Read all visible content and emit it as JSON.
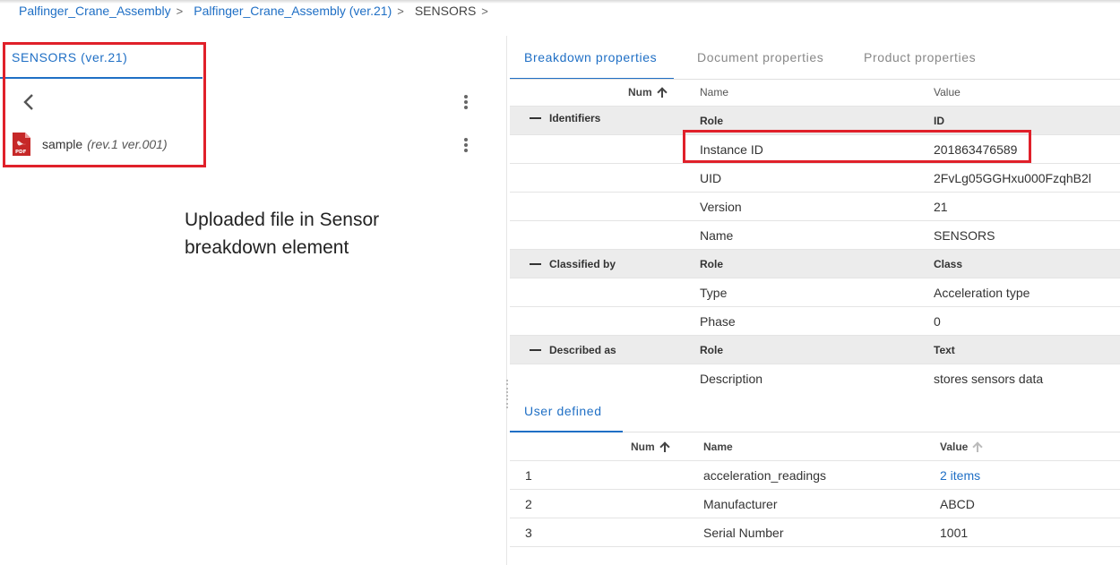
{
  "breadcrumb": {
    "items": [
      "Palfinger_Crane_Assembly",
      "Palfinger_Crane_Assembly (ver.21)"
    ],
    "current": "SENSORS"
  },
  "left_panel": {
    "tab_label": "SENSORS (ver.21)",
    "file": {
      "name": "sample",
      "revision": "(rev.1 ver.001)",
      "icon": "pdf-icon"
    },
    "annotation": "Uploaded file in Sensor breakdown element"
  },
  "tabs": [
    "Breakdown properties",
    "Document properties",
    "Product properties"
  ],
  "properties": {
    "headers": {
      "num": "Num",
      "name": "Name",
      "value": "Value"
    },
    "groups": [
      {
        "label": "Identifiers",
        "col_name": "Role",
        "col_value": "ID",
        "rows": [
          {
            "name": "Instance ID",
            "value": "201863476589"
          },
          {
            "name": "UID",
            "value": "2FvLg05GGHxu000FzqhB2l"
          },
          {
            "name": "Version",
            "value": "21"
          },
          {
            "name": "Name",
            "value": "SENSORS"
          }
        ]
      },
      {
        "label": "Classified by",
        "col_name": "Role",
        "col_value": "Class",
        "rows": [
          {
            "name": "Type",
            "value": "Acceleration type"
          },
          {
            "name": "Phase",
            "value": "0"
          }
        ]
      },
      {
        "label": "Described as",
        "col_name": "Role",
        "col_value": "Text",
        "rows": [
          {
            "name": "Description",
            "value": "stores sensors data"
          }
        ]
      }
    ]
  },
  "user_defined": {
    "tab_label": "User defined",
    "headers": {
      "num": "Num",
      "name": "Name",
      "value": "Value"
    },
    "rows": [
      {
        "num": "1",
        "name": "acceleration_readings",
        "value": "2 items"
      },
      {
        "num": "2",
        "name": "Manufacturer",
        "value": "ABCD"
      },
      {
        "num": "3",
        "name": "Serial Number",
        "value": "1001"
      }
    ]
  },
  "colors": {
    "accent": "#1f6fc5",
    "highlight": "#e0202a",
    "group_bg": "#ececec"
  }
}
